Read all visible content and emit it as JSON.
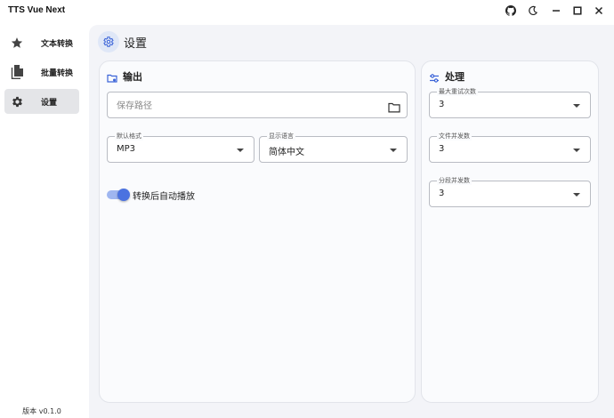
{
  "app": {
    "title": "TTS Vue Next"
  },
  "titlebar": {
    "icons": [
      "github-icon",
      "moon-icon",
      "minimize-icon",
      "maximize-icon",
      "close-icon"
    ]
  },
  "sidebar": {
    "items": [
      {
        "label": "文本转换",
        "icon": "star-icon",
        "active": false
      },
      {
        "label": "批量转换",
        "icon": "file-icon",
        "active": false
      },
      {
        "label": "设置",
        "icon": "gear-icon",
        "active": true
      }
    ],
    "version": "版本 v0.1.0"
  },
  "page": {
    "title": "设置",
    "icon": "gear-icon"
  },
  "output_card": {
    "title": "输出",
    "icon": "folder-settings-icon",
    "save_path": {
      "value": "",
      "placeholder": "保存路径"
    },
    "default_format": {
      "label": "默认格式",
      "value": "MP3"
    },
    "display_language": {
      "label": "显示语言",
      "value": "简体中文"
    },
    "auto_play": {
      "label": "转换后自动播放",
      "enabled": true
    }
  },
  "process_card": {
    "title": "处理",
    "icon": "sliders-icon",
    "max_retries": {
      "label": "最大重试次数",
      "value": "3"
    },
    "file_concurrency": {
      "label": "文件并发数",
      "value": "3"
    },
    "segment_concurrency": {
      "label": "分段并发数",
      "value": "3"
    }
  },
  "colors": {
    "accent": "#4b72e0",
    "accent_light": "#9fb6f0",
    "active_nav": "#e4e5e8",
    "content_bg": "#f3f4f8"
  }
}
